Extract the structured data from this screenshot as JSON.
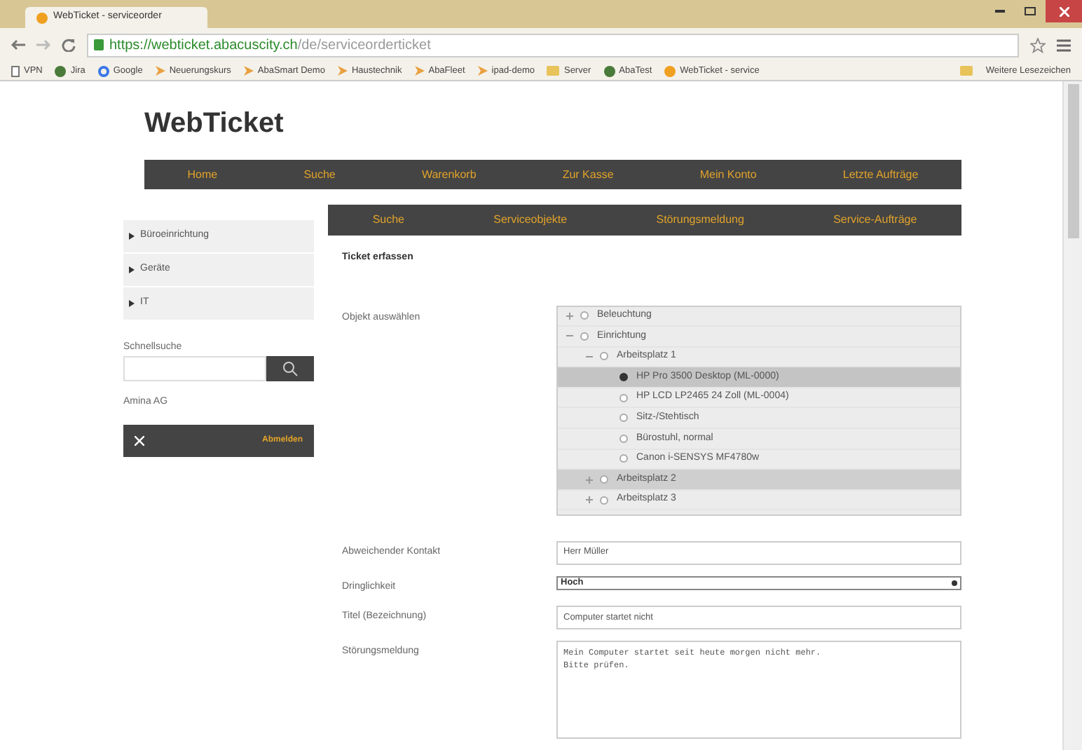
{
  "browser": {
    "tab_title": "WebTicket - serviceorder",
    "url_host": "https://webticket.abacuscity.ch",
    "url_path": "/de/serviceorderticket",
    "bookmarks": [
      {
        "label": "VPN",
        "kind": "page"
      },
      {
        "label": "Jira",
        "kind": "app"
      },
      {
        "label": "Google",
        "kind": "google"
      },
      {
        "label": "Neuerungskurs",
        "kind": "link"
      },
      {
        "label": "AbaSmart Demo",
        "kind": "link"
      },
      {
        "label": "Haustechnik",
        "kind": "link"
      },
      {
        "label": "AbaFleet",
        "kind": "link"
      },
      {
        "label": "ipad-demo",
        "kind": "link"
      },
      {
        "label": "Server",
        "kind": "folder"
      },
      {
        "label": "AbaTest",
        "kind": "app"
      },
      {
        "label": "WebTicket - service",
        "kind": "site"
      }
    ],
    "other_bookmarks": "Weitere Lesezeichen"
  },
  "site_title": "WebTicket",
  "main_nav": [
    "Home",
    "Suche",
    "Warenkorb",
    "Zur Kasse",
    "Mein Konto",
    "Letzte Aufträge"
  ],
  "sidebar": {
    "items": [
      "Büroeinrichtung",
      "Geräte",
      "IT"
    ],
    "search_label": "Schnellsuche",
    "company": "Amina AG",
    "logout": "Abmelden"
  },
  "sub_nav": [
    "Suche",
    "Serviceobjekte",
    "Störungsmeldung",
    "Service-Aufträge"
  ],
  "section_title": "Ticket erfassen",
  "object_label": "Objekt auswählen",
  "tree": [
    {
      "label": "Beleuchtung",
      "expanded": false,
      "selected": false,
      "hovered": false
    },
    {
      "label": "Einrichtung",
      "expanded": true,
      "selected": false,
      "hovered": false,
      "children": [
        {
          "label": "Arbeitsplatz 1",
          "expanded": true,
          "selected": false,
          "hovered": false,
          "children": [
            {
              "label": "HP Pro 3500 Desktop   (ML-0000)",
              "selected": true,
              "hovered": false
            },
            {
              "label": "HP LCD LP2465 24 Zoll   (ML-0004)",
              "selected": false,
              "hovered": false
            },
            {
              "label": "Sitz-/Stehtisch",
              "selected": false,
              "hovered": false
            },
            {
              "label": "Bürostuhl, normal",
              "selected": false,
              "hovered": false
            },
            {
              "label": "Canon i-SENSYS MF4780w",
              "selected": false,
              "hovered": false
            }
          ]
        },
        {
          "label": "Arbeitsplatz 2",
          "expanded": false,
          "selected": false,
          "hovered": true
        },
        {
          "label": "Arbeitsplatz 3",
          "expanded": false,
          "selected": false,
          "hovered": false
        }
      ]
    }
  ],
  "form": [
    {
      "label": "Abweichender Kontakt",
      "kind": "text",
      "value": "Herr Müller"
    },
    {
      "label": "Dringlichkeit",
      "kind": "select",
      "value": "Hoch"
    },
    {
      "label": "Titel (Bezeichnung)",
      "kind": "text",
      "value": "Computer startet nicht"
    },
    {
      "label": "Störungsmeldung",
      "kind": "textarea",
      "value": "Mein Computer startet seit heute morgen nicht mehr.\nBitte prüfen."
    }
  ]
}
